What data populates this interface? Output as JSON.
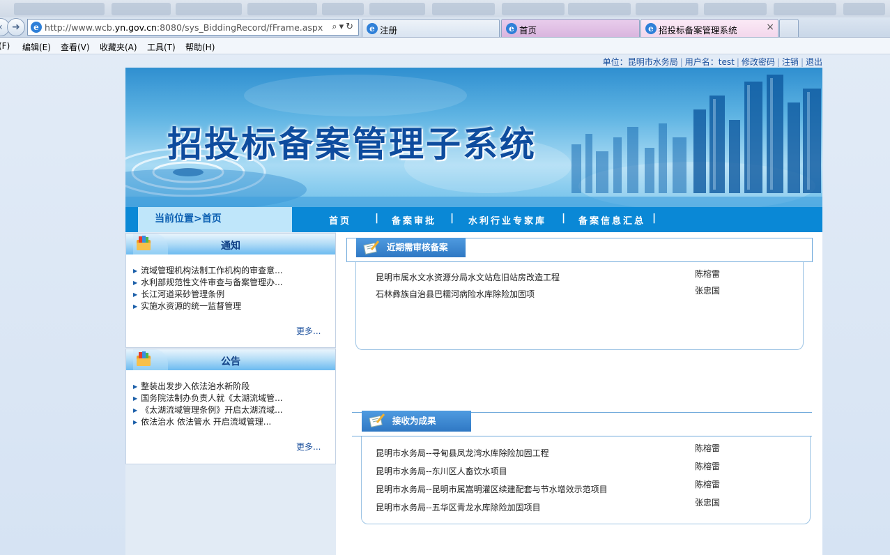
{
  "browser": {
    "url_prefix": "http://www.wcb.",
    "url_domain": "yn.gov.cn",
    "url_suffix": ":8080/sys_BiddingRecord/fFrame.aspx",
    "tabs": [
      {
        "label": "注册"
      },
      {
        "label": "首页"
      },
      {
        "label": "招投标备案管理系统",
        "close": "×"
      }
    ],
    "menu": [
      "文件(F)",
      "编辑(E)",
      "查看(V)",
      "收藏夹(A)",
      "工具(T)",
      "帮助(H)"
    ],
    "menu_first_visible": "(F)"
  },
  "userbar": {
    "unit_label": "单位：",
    "unit_value": "昆明市水务局",
    "user_label": "用户名：",
    "user_value": "test",
    "change_password": "修改密码",
    "logout": "注销",
    "exit": "退出",
    "sep": "|"
  },
  "banner": {
    "title": "招投标备案管理子系统"
  },
  "nav": {
    "breadcrumb": "当前位置>首页",
    "links": [
      "首页",
      "备案审批",
      "水利行业专家库",
      "备案信息汇总"
    ],
    "sep": "|"
  },
  "notice_panel": {
    "title": "通知",
    "items": [
      "流域管理机构法制工作机构的审查意...",
      "水利部规范性文件审查与备案管理办...",
      "长江河道采砂管理条例",
      "实施水资源的统一监督管理"
    ],
    "more": "更多..."
  },
  "announce_panel": {
    "title": "公告",
    "items": [
      "整装出发步入依法治水新阶段",
      "国务院法制办负责人就《太湖流域管...",
      "《太湖流域管理条例》开启太湖流域...",
      "依法治水 依法管水 开启流域管理..."
    ],
    "more": "更多..."
  },
  "pending": {
    "title": "近期需审核备案",
    "rows": [
      {
        "project": "昆明市属水文水资源分局水文站危旧站房改造工程",
        "person": "陈榕雷"
      },
      {
        "project": "石林彝族自治县巴糯河病险水库除险加固项",
        "person": "张忠国"
      }
    ]
  },
  "results": {
    "title": "接收为成果",
    "rows": [
      {
        "project": "昆明市水务局--寻甸县凤龙湾水库除险加固工程",
        "person": "陈榕雷"
      },
      {
        "project": "昆明市水务局--东川区人畜饮水项目",
        "person": "陈榕雷"
      },
      {
        "project": "昆明市水务局--昆明市属嵩明灌区续建配套与节水增效示范项目",
        "person": "陈榕雷"
      },
      {
        "project": "昆明市水务局--五华区青龙水库除险加固项目",
        "person": "张忠国"
      }
    ]
  },
  "colors": {
    "nav_blue": "#0a88d6",
    "breadcrumb_bg": "#bfe6fa",
    "link_blue": "#1a4f9c",
    "banner_title": "#0e4c9e"
  },
  "icons": {
    "back": "back-arrow-icon",
    "forward": "forward-arrow-icon",
    "search": "search-icon",
    "refresh": "refresh-icon",
    "tab": "ie-icon",
    "panel": "folder-books-icon",
    "section": "document-pen-icon"
  }
}
